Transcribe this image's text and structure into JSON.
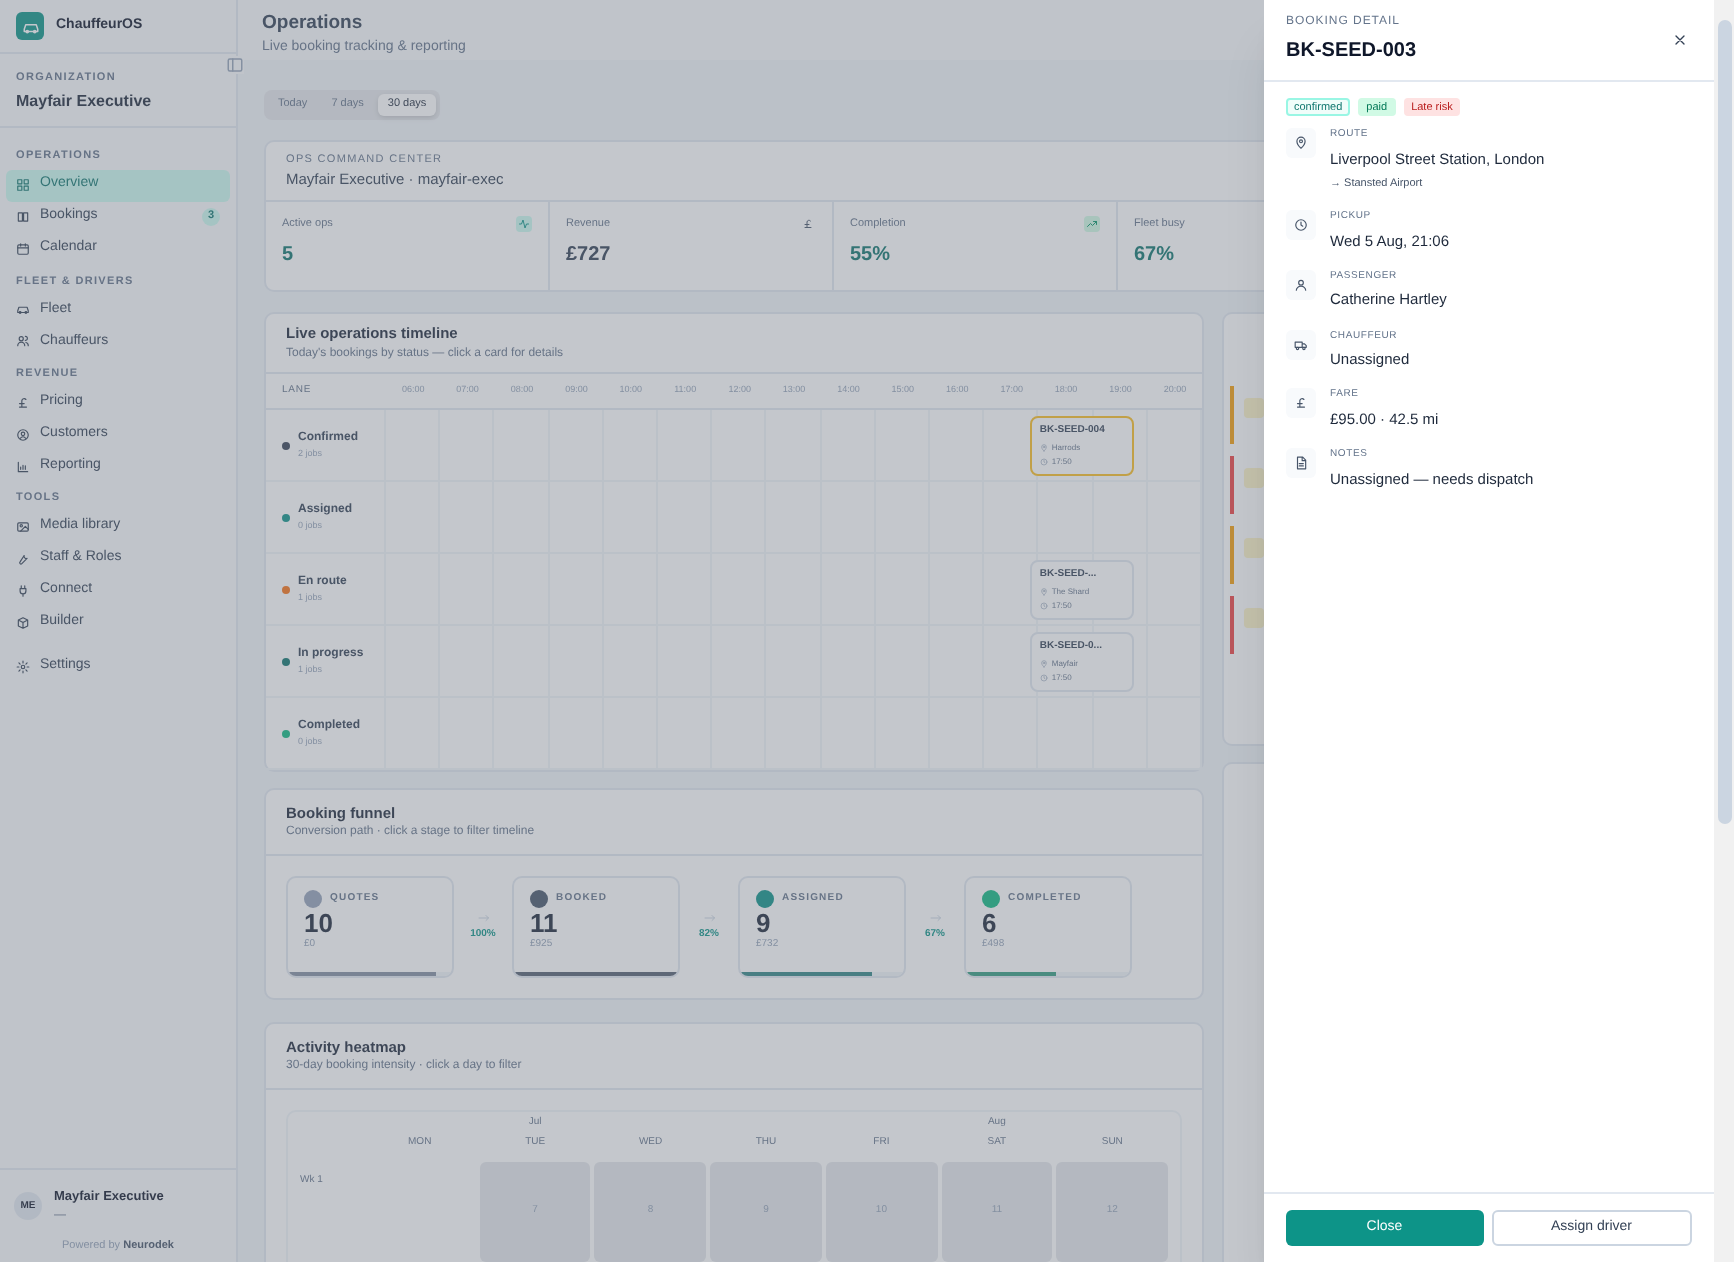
{
  "sidebar": {
    "brand": "ChauffeurOS",
    "org_label": "ORGANIZATION",
    "org_name": "Mayfair Executive",
    "groups": [
      {
        "label": "OPERATIONS",
        "items": [
          {
            "label": "Overview",
            "selected": true
          },
          {
            "label": "Bookings",
            "selected": false,
            "badge": "3"
          },
          {
            "label": "Calendar",
            "selected": false
          }
        ]
      },
      {
        "label": "FLEET & DRIVERS",
        "items": [
          {
            "label": "Fleet",
            "selected": false
          },
          {
            "label": "Chauffeurs",
            "selected": false
          }
        ]
      },
      {
        "label": "REVENUE",
        "items": [
          {
            "label": "Pricing",
            "selected": false
          },
          {
            "label": "Customers",
            "selected": false
          },
          {
            "label": "Reporting",
            "selected": false
          }
        ]
      },
      {
        "label": "TOOLS",
        "items": [
          {
            "label": "Media library",
            "selected": false
          },
          {
            "label": "Staff & Roles",
            "selected": false
          },
          {
            "label": "Connect",
            "selected": false
          },
          {
            "label": "Builder",
            "selected": false
          }
        ]
      },
      {
        "items": [
          {
            "label": "Settings",
            "selected": false
          }
        ]
      }
    ],
    "footer": {
      "initials": "ME",
      "name": "Mayfair Executive",
      "sub": "—",
      "powered_prefix": "Powered by",
      "powered_brand": "Neurodek"
    }
  },
  "header": {
    "title": "Operations",
    "subtitle": "Live booking tracking & reporting"
  },
  "ranges": [
    {
      "label": "Today",
      "selected": false
    },
    {
      "label": "7 days",
      "selected": false
    },
    {
      "label": "30 days",
      "selected": true
    }
  ],
  "command_center": {
    "label": "OPS COMMAND CENTER",
    "title": "Mayfair Executive · mayfair-exec",
    "stats": [
      {
        "label": "Active ops",
        "value": "5",
        "kind": "pulse"
      },
      {
        "label": "Revenue",
        "value": "£727",
        "kind": "currency"
      },
      {
        "label": "Completion",
        "value": "55%",
        "kind": "trend"
      },
      {
        "label": "Fleet busy",
        "value": "67%",
        "kind": "fleet"
      }
    ]
  },
  "timeline": {
    "title": "Live operations timeline",
    "subtitle": "Today's bookings by status — click a card for details",
    "lane_header": "LANE",
    "hours": [
      "06:00",
      "07:00",
      "08:00",
      "09:00",
      "10:00",
      "11:00",
      "12:00",
      "13:00",
      "14:00",
      "15:00",
      "16:00",
      "17:00",
      "18:00",
      "19:00",
      "20:00"
    ],
    "lanes": [
      {
        "name": "Confirmed",
        "count": "2 jobs",
        "color": "#4b5566",
        "bookings": [
          {
            "ref": "BK-SEED-004",
            "place": "Harrods",
            "time": "17:50",
            "late_risk": true
          }
        ]
      },
      {
        "name": "Assigned",
        "count": "0 jobs",
        "color": "#338685"
      },
      {
        "name": "En route",
        "count": "1 jobs",
        "color": "#c07340",
        "bookings": [
          {
            "ref": "BK-SEED-...",
            "place": "The Shard",
            "time": "17:50",
            "late_risk": false
          }
        ]
      },
      {
        "name": "In progress",
        "count": "1 jobs",
        "color": "#347475",
        "bookings": [
          {
            "ref": "BK-SEED-0...",
            "place": "Mayfair",
            "time": "17:50",
            "late_risk": false
          }
        ]
      },
      {
        "name": "Completed",
        "count": "0 jobs",
        "color": "#349d81"
      }
    ]
  },
  "funnel": {
    "title": "Booking funnel",
    "subtitle": "Conversion path · click a stage to filter timeline",
    "stages": [
      {
        "label": "QUOTES",
        "value": "10",
        "amount": "£0",
        "level": 0.9,
        "color": "#848fa2"
      },
      {
        "label": "BOOKED",
        "value": "11",
        "amount": "£925",
        "level": 1,
        "color": "#556172"
      },
      {
        "label": "ASSIGNED",
        "value": "9",
        "amount": "£732",
        "level": 0.8,
        "color": "#338685"
      },
      {
        "label": "COMPLETED",
        "value": "6",
        "amount": "£498",
        "level": 0.55,
        "color": "#349d81"
      }
    ],
    "conversions": [
      "100%",
      "82%",
      "67%"
    ]
  },
  "heatmap": {
    "title": "Activity heatmap",
    "subtitle": "30-day booking intensity · click a day to filter",
    "days": [
      {
        "label": "MON"
      },
      {
        "label": "TUE",
        "month": "Jul"
      },
      {
        "label": "WED"
      },
      {
        "label": "THU"
      },
      {
        "label": "FRI"
      },
      {
        "label": "SAT",
        "month": "Aug"
      },
      {
        "label": "SUN"
      }
    ],
    "weeks": [
      {
        "label": "Wk 1",
        "cells": [
          "",
          "7",
          "8",
          "9",
          "10",
          "11",
          "12"
        ]
      }
    ]
  },
  "drawer": {
    "label": "BOOKING DETAIL",
    "title": "BK-SEED-003",
    "badges": [
      {
        "text": "confirmed",
        "kind": "status"
      },
      {
        "text": "paid",
        "kind": "payment"
      },
      {
        "text": "Late risk",
        "kind": "risk"
      }
    ],
    "fields": [
      {
        "label": "ROUTE",
        "value": "Liverpool Street Station, London",
        "sub": "→ Stansted Airport",
        "kind": "route"
      },
      {
        "label": "PICKUP",
        "value": "Wed 5 Aug, 21:06",
        "kind": "time"
      },
      {
        "label": "PASSENGER",
        "value": "Catherine Hartley",
        "kind": "person"
      },
      {
        "label": "CHAUFFEUR",
        "value": "Unassigned",
        "kind": "vehicle"
      },
      {
        "label": "FARE",
        "value": "£95.00 · 42.5 mi",
        "kind": "fare"
      },
      {
        "label": "NOTES",
        "value": "Unassigned — needs dispatch",
        "kind": "notes"
      }
    ],
    "buttons": [
      {
        "label": "Close",
        "kind": "primary"
      },
      {
        "label": "Assign driver",
        "kind": "secondary"
      }
    ]
  }
}
